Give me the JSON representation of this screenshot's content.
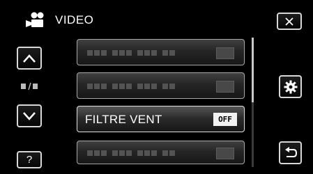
{
  "header": {
    "title": "VIDEO",
    "icon": "movie-camera-icon"
  },
  "nav": {
    "page_indicator_icon": "page-indicator-icon"
  },
  "menu": {
    "items": [
      {
        "label": "",
        "value": "",
        "state": "dimmed"
      },
      {
        "label": "",
        "value": "",
        "state": "dimmed"
      },
      {
        "label": "FILTRE VENT",
        "value": "OFF",
        "state": "active"
      },
      {
        "label": "",
        "value": "",
        "state": "dimmed"
      }
    ]
  },
  "scrollbar": {
    "position_fraction": 0.5
  },
  "buttons": {
    "close_icon": "close-icon",
    "up_icon": "chevron-up-icon",
    "down_icon": "chevron-down-icon",
    "help_label": "?",
    "settings_icon": "gear-icon",
    "back_icon": "return-icon"
  },
  "colors": {
    "background": "#000000",
    "button_border": "#d8d8d8",
    "value_badge": "#f2f2f2"
  }
}
